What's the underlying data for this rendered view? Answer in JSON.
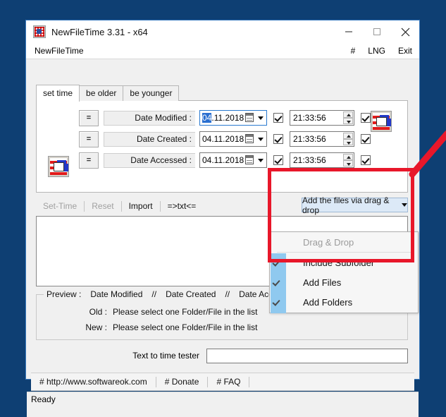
{
  "window": {
    "title": "NewFileTime 3.31 - x64",
    "icon": "app-checkerboard-icon",
    "minimize_label": "–",
    "maximize_label": "□",
    "close_label": "✕"
  },
  "menubar": {
    "app_menu": "NewFileTime",
    "hash": "#",
    "language": "LNG",
    "exit": "Exit"
  },
  "tabs": [
    {
      "label": "set time",
      "active": true
    },
    {
      "label": "be older",
      "active": false
    },
    {
      "label": "be younger",
      "active": false
    }
  ],
  "date_rows": [
    {
      "equals_button": "=",
      "label": "Date Modified :",
      "date_selected_part": "04",
      "date_rest": ".11.2018",
      "date_checkbox_checked": true,
      "time_value": "21:33:56",
      "time_checkbox_checked": true,
      "focused": true
    },
    {
      "equals_button": "=",
      "label": "Date Created :",
      "date_selected_part": "",
      "date_rest": "04.11.2018",
      "date_checkbox_checked": true,
      "time_value": "21:33:56",
      "time_checkbox_checked": true,
      "focused": false
    },
    {
      "equals_button": "=",
      "label": "Date Accessed :",
      "date_selected_part": "",
      "date_rest": "04.11.2018",
      "date_checkbox_checked": true,
      "time_value": "21:33:56",
      "time_checkbox_checked": true,
      "focused": false
    }
  ],
  "toolbar": {
    "set_time": "Set-Time",
    "reset": "Reset",
    "import": "Import",
    "to_txt": "=>txt<=",
    "set_time_enabled": false,
    "reset_enabled": false,
    "combo_label": "Add the files via drag & drop"
  },
  "dropdown": {
    "header": "Drag & Drop",
    "items": [
      {
        "label": "Include Subfolder",
        "checked": true
      },
      {
        "label": "Add Files",
        "checked": true
      },
      {
        "label": "Add Folders",
        "checked": true
      }
    ]
  },
  "preview": {
    "title_prefix": "Preview :",
    "title_col1": "Date Modified",
    "title_sep1": "//",
    "title_col2": "Date Created",
    "title_sep2": "//",
    "title_col3": "Date Accessed",
    "old_label": "Old :",
    "old_value": "Please select one Folder/File in the list",
    "new_label": "New :",
    "new_value": "Please select one Folder/File in the list"
  },
  "tester": {
    "label": "Text to time tester",
    "value": "",
    "placeholder": ""
  },
  "links": [
    {
      "label": "# http://www.softwareok.com"
    },
    {
      "label": "# Donate"
    },
    {
      "label": "# FAQ"
    }
  ],
  "status": {
    "text": "Ready"
  },
  "annotations": {
    "highlight_color": "#e8172a",
    "rect_note": "highlight around drag & drop dropdown",
    "arrow_note": "red arrow pointing to dropdown"
  }
}
